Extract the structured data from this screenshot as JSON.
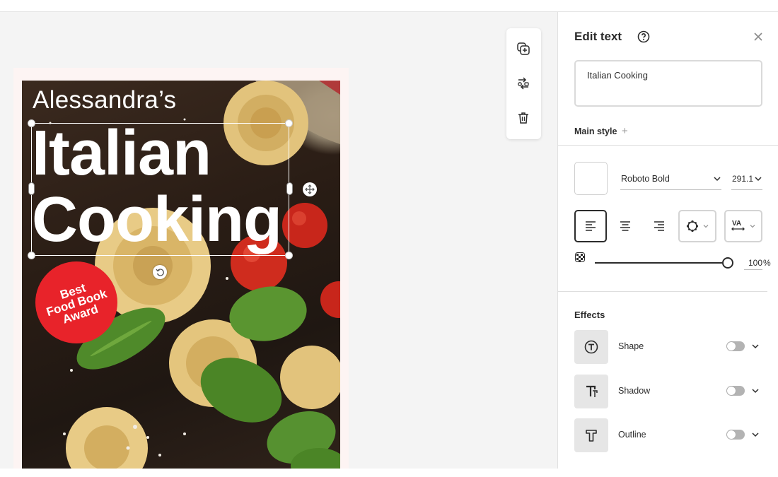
{
  "poster": {
    "author": "Alessandra’s",
    "title_line1": "Italian",
    "title_line2": "Cooking",
    "badge": [
      "Best",
      "Food Book",
      "Award"
    ]
  },
  "panel": {
    "title": "Edit text",
    "text_value": "Italian Cooking",
    "main_style_label": "Main style",
    "main_style_add": "+",
    "font_family": "Roboto Bold",
    "font_size": "291.1",
    "opacity_value": "100",
    "opacity_unit": "%",
    "effects_title": "Effects",
    "effects": [
      {
        "label": "Shape",
        "enabled": false
      },
      {
        "label": "Shadow",
        "enabled": false
      },
      {
        "label": "Outline",
        "enabled": false
      }
    ]
  },
  "colors": {
    "badge": "#e8232a",
    "text": "#ffffff",
    "canvas": "#f4f4f4",
    "panel_text": "#2c2c2c"
  },
  "icons": {
    "toolbar": [
      "duplicate-icon",
      "replace-icon",
      "trash-icon"
    ],
    "align": [
      "align-left-icon",
      "align-center-icon",
      "align-right-icon"
    ]
  }
}
